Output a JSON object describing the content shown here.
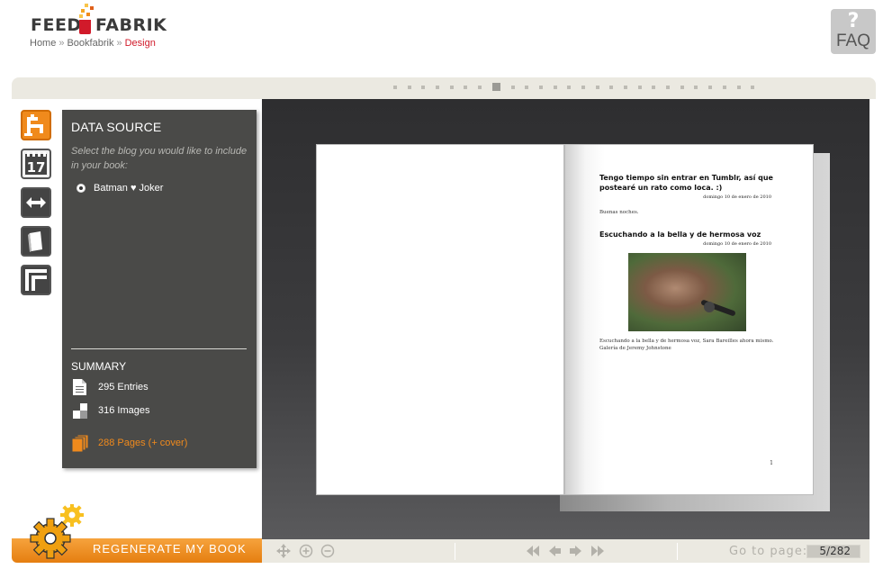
{
  "header": {
    "logo_left": "FEED",
    "logo_right": "FABRIK",
    "breadcrumb": [
      {
        "label": "Home"
      },
      {
        "label": "Bookfabrik"
      },
      {
        "label": "Design"
      }
    ],
    "breadcrumb_separator": "»",
    "faq_glyph": "?",
    "faq_label": "FAQ"
  },
  "stepbar": {
    "step_count": 26,
    "active_step": 7
  },
  "tools": [
    {
      "name": "data-source-tool",
      "icon": "faucet-icon",
      "active": true
    },
    {
      "name": "date-tool",
      "icon": "calendar-icon",
      "active": false,
      "label": "17"
    },
    {
      "name": "size-tool",
      "icon": "double-arrow-icon",
      "active": false
    },
    {
      "name": "cover-tool",
      "icon": "book-icon",
      "active": false
    },
    {
      "name": "layout-tool",
      "icon": "frame-icon",
      "active": false
    }
  ],
  "panel": {
    "title": "DATA SOURCE",
    "hint": "Select the blog you would like to include in your book:",
    "blog": "Batman ♥ Joker",
    "summary_title": "SUMMARY",
    "entries": "295 Entries",
    "images": "316 Images",
    "pages": "288 Pages (+ cover)"
  },
  "regenerate": {
    "label": "REGENERATE MY BOOK"
  },
  "book": {
    "right_page": {
      "post1_title": "Tengo tiempo sin entrar en Tumblr, así que postearé un rato como loca. :)",
      "post1_date": "domingo 10 de enero de 2010",
      "post1_body": "Buenas noches.",
      "post2_title": "Escuchando a la bella y de hermosa voz",
      "post2_date": "domingo 10 de enero de 2010",
      "post2_caption": "Escuchando a la bella y de hermosa voz, Sara Bareilles ahora mismo. Galería de Jeremy Johnstone",
      "page_number": "1"
    }
  },
  "controls": {
    "goto_label": "Go to page:",
    "goto_value": "5/282"
  },
  "colors": {
    "accent": "#f08a1c",
    "brand_red": "#d11a2a",
    "panel_bg": "#4a4a48"
  }
}
